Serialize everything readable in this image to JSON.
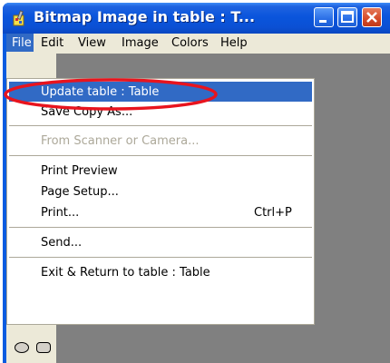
{
  "window": {
    "title": "Bitmap Image in table : T..."
  },
  "menubar": {
    "items": [
      {
        "label": "File"
      },
      {
        "label": "Edit"
      },
      {
        "label": "View"
      },
      {
        "label": "Image"
      },
      {
        "label": "Colors"
      },
      {
        "label": "Help"
      }
    ]
  },
  "file_menu": {
    "items": [
      {
        "label": "Update table : Table",
        "state": "selected"
      },
      {
        "label": "Save Copy As..."
      },
      {
        "label": "From Scanner or Camera...",
        "state": "disabled"
      },
      {
        "label": "Print Preview"
      },
      {
        "label": "Page Setup..."
      },
      {
        "label": "Print...",
        "shortcut": "Ctrl+P"
      },
      {
        "label": "Send..."
      },
      {
        "label": "Exit & Return to table : Table"
      }
    ]
  },
  "toolbox": {
    "tools": [
      "ellipse-tool",
      "rounded-rectangle-tool"
    ]
  },
  "colors": {
    "titlebar": "#0a55dc",
    "selection": "#316ac5",
    "close_button": "#d54a28",
    "annotation": "#e8141e",
    "menu_background": "#ffffff",
    "disabled_text": "#aca899"
  }
}
